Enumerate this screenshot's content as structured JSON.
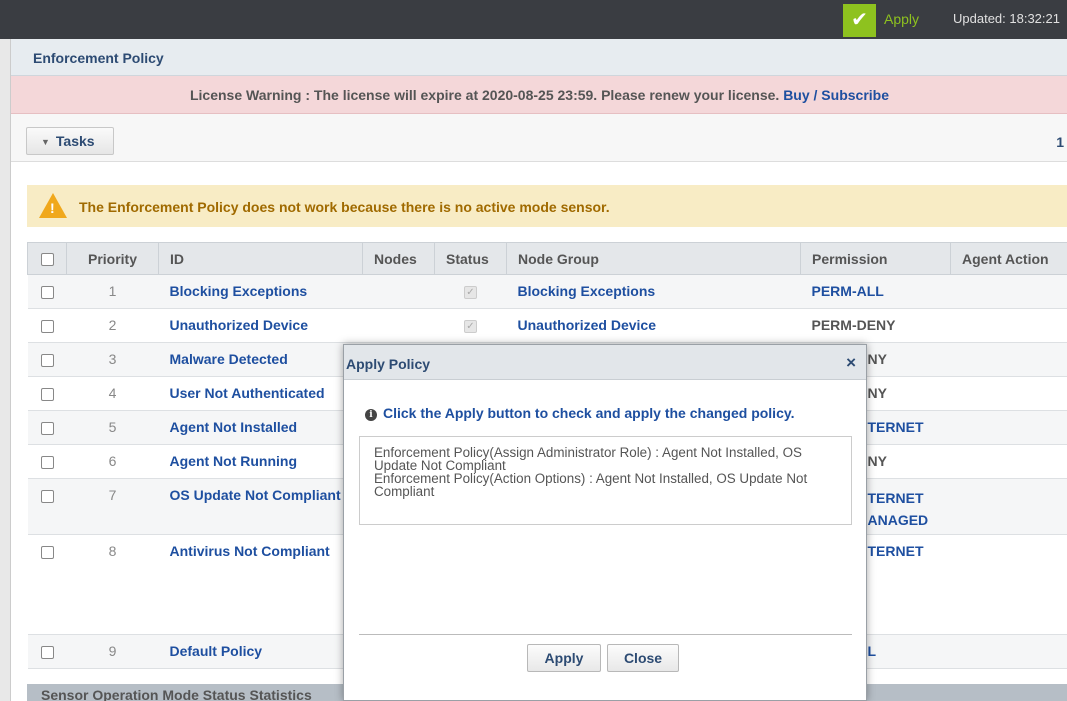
{
  "topbar": {
    "apply_label": "Apply",
    "updated_text": "Updated: 18:32:21"
  },
  "page": {
    "title": "Enforcement Policy",
    "license_warning": "License Warning : The license will expire at 2020-08-25 23:59. Please renew your license.",
    "license_link": "Buy / Subscribe",
    "tasks_label": "Tasks",
    "page_number": "1",
    "warning_message": "The Enforcement Policy does not work because there is no active mode sensor.",
    "stats_title": "Sensor Operation Mode Status Statistics"
  },
  "table": {
    "headers": {
      "priority": "Priority",
      "id": "ID",
      "nodes": "Nodes",
      "status": "Status",
      "node_group": "Node Group",
      "permission": "Permission",
      "agent_action": "Agent Action"
    },
    "rows": [
      {
        "priority": "1",
        "id": "Blocking Exceptions",
        "node_group": "Blocking Exceptions",
        "permission": "PERM-ALL",
        "status_checked": true
      },
      {
        "priority": "2",
        "id": "Unauthorized Device",
        "node_group": "Unauthorized Device",
        "permission": "PERM-DENY",
        "status_checked": true
      },
      {
        "priority": "3",
        "id": "Malware Detected",
        "permission": "NY"
      },
      {
        "priority": "4",
        "id": "User Not Authenticated",
        "permission": "NY"
      },
      {
        "priority": "5",
        "id": "Agent Not Installed",
        "permission": "TERNET"
      },
      {
        "priority": "6",
        "id": "Agent Not Running",
        "permission": "NY"
      },
      {
        "priority": "7",
        "id": "OS Update Not Compliant",
        "permission": "TERNET",
        "permission2": "ANAGED"
      },
      {
        "priority": "8",
        "id": "Antivirus Not Compliant",
        "permission": "TERNET"
      },
      {
        "priority": "9",
        "id": "Default Policy",
        "permission": "L"
      }
    ]
  },
  "modal": {
    "title": "Apply Policy",
    "close_glyph": "×",
    "info_message": "Click the Apply button to check and apply the changed policy.",
    "changes": [
      "Enforcement Policy(Assign Administrator Role) : Agent Not Installed, OS Update Not Compliant",
      "Enforcement Policy(Action Options) : Agent Not Installed, OS Update Not Compliant"
    ],
    "apply_button": "Apply",
    "close_button": "Close"
  },
  "colors": {
    "accent_green": "#8ec21f",
    "link_blue": "#1e4fa0",
    "license_bg": "#f4d7d9",
    "warning_bg": "#f8ecc5"
  },
  "icons": [
    "check-icon",
    "caret-down-icon",
    "warning-icon",
    "info-icon",
    "close-icon"
  ]
}
